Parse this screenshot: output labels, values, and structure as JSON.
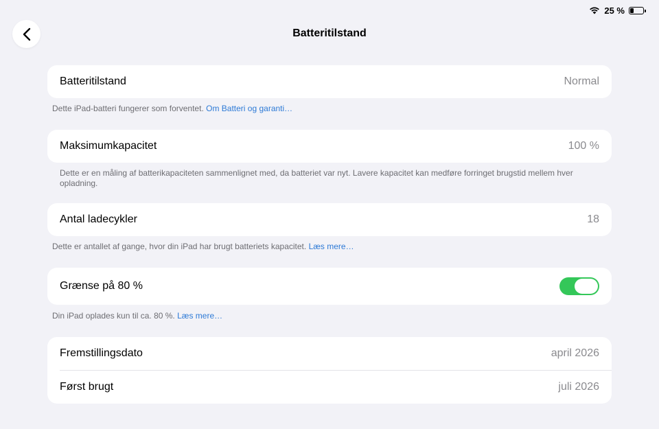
{
  "status_bar": {
    "battery_percent_label": "25 %",
    "battery_level": 0.25,
    "wifi_icon": "wifi-icon",
    "battery_icon": "battery-icon"
  },
  "nav": {
    "title": "Batteritilstand",
    "back_icon": "chevron-left-icon"
  },
  "sections": {
    "health": {
      "label": "Batteritilstand",
      "value": "Normal",
      "note": "Dette iPad-batteri fungerer som forventet.",
      "link": "Om Batteri og garanti…"
    },
    "capacity": {
      "label": "Maksimumkapacitet",
      "value": "100 %",
      "note": "Dette er en måling af batterikapaciteten sammenlignet med, da batteriet var nyt. Lavere kapacitet kan medføre forringet brugstid mellem hver opladning."
    },
    "cycles": {
      "label": "Antal ladecykler",
      "value": "18",
      "note": "Dette er antallet af gange, hvor din iPad har brugt batteriets kapacitet.",
      "link": "Læs mere…"
    },
    "limit": {
      "label": "Grænse på 80 %",
      "enabled": true,
      "note": "Din iPad oplades kun til ca. 80 %.",
      "link": "Læs mere…"
    },
    "dates": {
      "manufactured_label": "Fremstillingsdato",
      "manufactured_value": "april 2026",
      "first_used_label": "Først brugt",
      "first_used_value": "juli 2026"
    }
  },
  "colors": {
    "accent_link": "#2d7ad6",
    "toggle_on": "#34c759",
    "background": "#f2f2f7"
  }
}
